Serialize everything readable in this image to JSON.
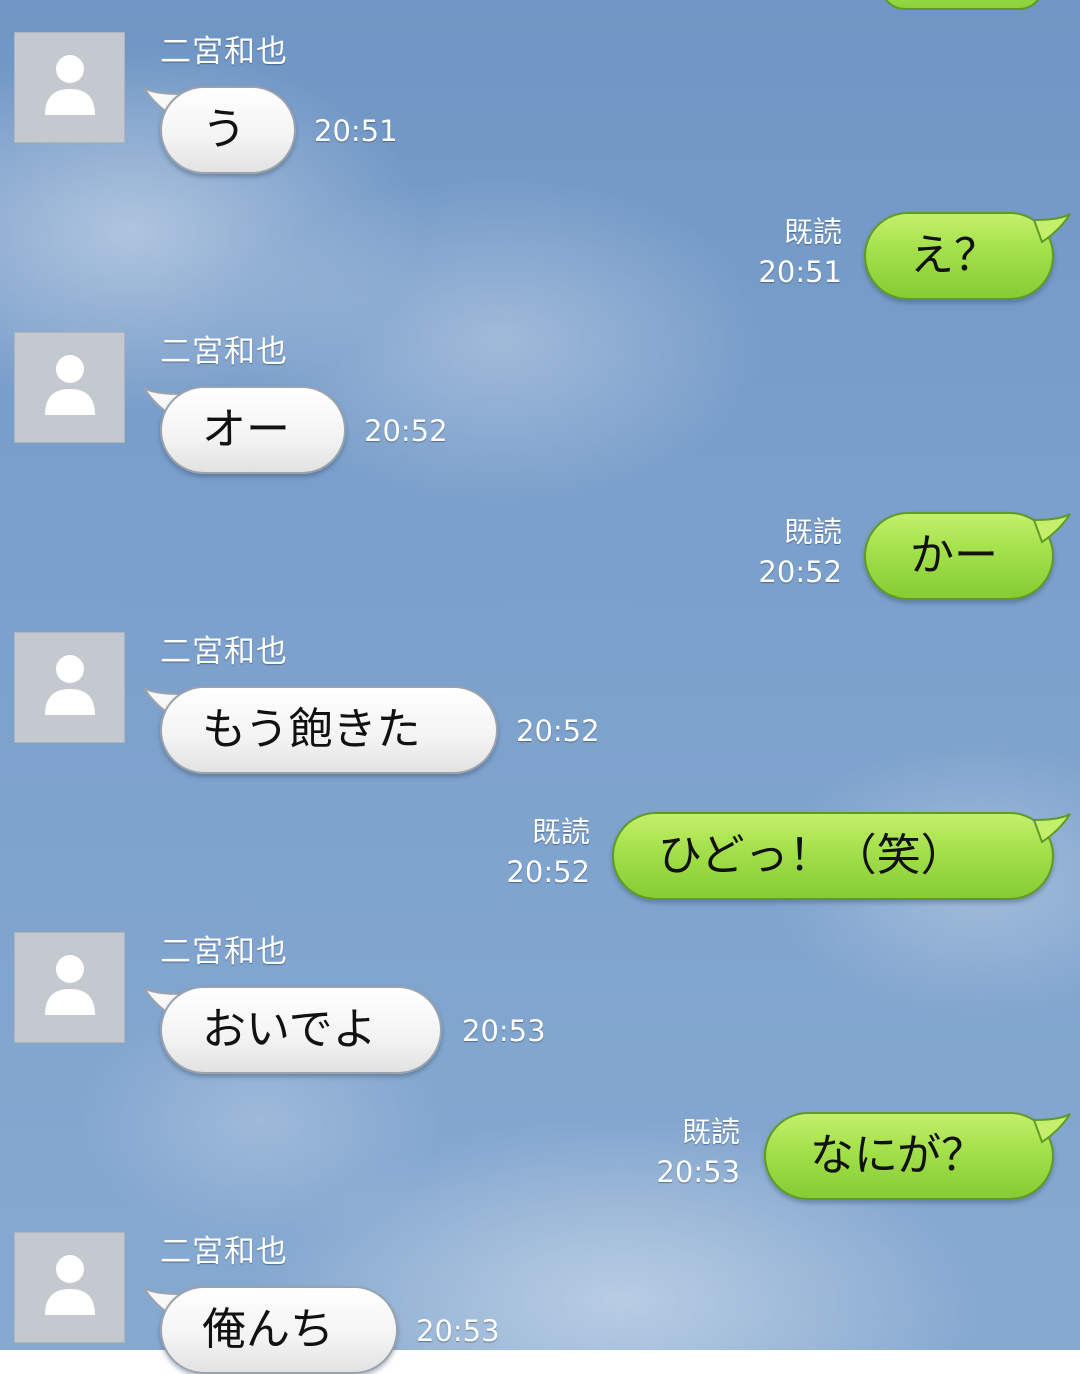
{
  "sender_name": "二宮和也",
  "read_label": "既読",
  "avatar_icon": "person-silhouette-icon",
  "colors": {
    "incoming_bubble": "#ffffff",
    "outgoing_bubble": "#a2e04a",
    "background_sky": "#7a9fcb"
  },
  "messages": [
    {
      "direction": "incoming",
      "text": "う",
      "time": "20:51"
    },
    {
      "direction": "outgoing",
      "text": "え？",
      "time": "20:51",
      "read": true
    },
    {
      "direction": "incoming",
      "text": "オー",
      "time": "20:52"
    },
    {
      "direction": "outgoing",
      "text": "かー",
      "time": "20:52",
      "read": true
    },
    {
      "direction": "incoming",
      "text": "もう飽きた",
      "time": "20:52"
    },
    {
      "direction": "outgoing",
      "text": "ひどっ！（笑）",
      "time": "20:52",
      "read": true
    },
    {
      "direction": "incoming",
      "text": "おいでよ",
      "time": "20:53"
    },
    {
      "direction": "outgoing",
      "text": "なにが？",
      "time": "20:53",
      "read": true
    },
    {
      "direction": "incoming",
      "text": "俺んち",
      "time": "20:53"
    }
  ]
}
